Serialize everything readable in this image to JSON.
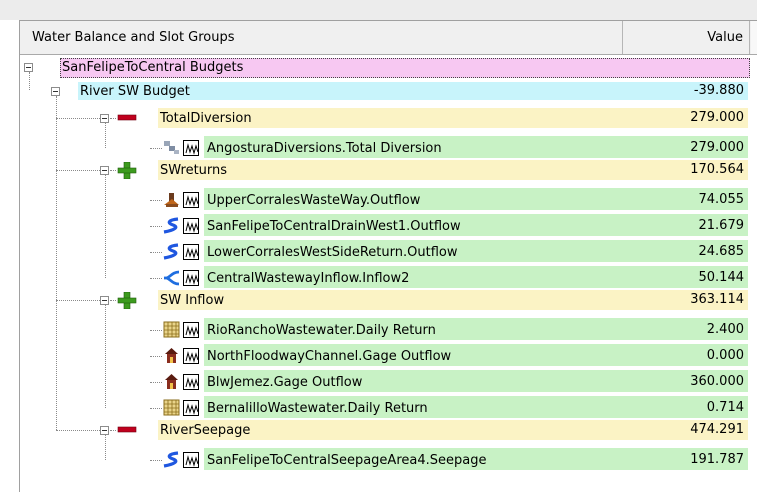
{
  "header": {
    "col_name": "Water Balance and Slot Groups",
    "col_value": "Value"
  },
  "colors": {
    "root_bg": "#f7c8f2",
    "budget_bg": "#c8f4fb",
    "group_bg": "#fbf3c5",
    "leaf_bg": "#c8f2c5",
    "minus_red": "#c0001e",
    "plus_green": "#3d9b1f"
  },
  "tree": {
    "root": {
      "label": "SanFelipeToCentral Budgets",
      "expanded": true
    },
    "budget": {
      "label": "River SW Budget",
      "value": "-39.880",
      "expanded": true
    },
    "groups": [
      {
        "label": "TotalDiversion",
        "value": "279.000",
        "sign": "minus-icon",
        "expanded": true,
        "items": [
          {
            "label": "AngosturaDiversions.Total Diversion",
            "value": "279.000",
            "icon": "diversion-object-icon"
          }
        ]
      },
      {
        "label": "SWreturns",
        "value": "170.564",
        "sign": "plus-icon",
        "expanded": true,
        "items": [
          {
            "label": "UpperCorralesWasteWay.Outflow",
            "value": "74.055",
            "icon": "pump-return-icon"
          },
          {
            "label": "SanFelipeToCentralDrainWest1.Outflow",
            "value": "21.679",
            "icon": "reach-icon"
          },
          {
            "label": "LowerCorralesWestSideReturn.Outflow",
            "value": "24.685",
            "icon": "reach-icon"
          },
          {
            "label": "CentralWastewayInflow.Inflow2",
            "value": "50.144",
            "icon": "confluence-icon"
          }
        ]
      },
      {
        "label": "SW Inflow",
        "value": "363.114",
        "sign": "plus-icon",
        "expanded": true,
        "items": [
          {
            "label": "RioRanchoWastewater.Daily Return",
            "value": "2.400",
            "icon": "data-table-icon"
          },
          {
            "label": "NorthFloodwayChannel.Gage Outflow",
            "value": "0.000",
            "icon": "gage-house-icon"
          },
          {
            "label": "BlwJemez.Gage Outflow",
            "value": "360.000",
            "icon": "gage-house-icon"
          },
          {
            "label": "BernalilloWastewater.Daily Return",
            "value": "0.714",
            "icon": "data-table-icon"
          }
        ]
      },
      {
        "label": "RiverSeepage",
        "value": "474.291",
        "sign": "minus-icon",
        "expanded": true,
        "items": [
          {
            "label": "SanFelipeToCentralSeepageArea4.Seepage",
            "value": "191.787",
            "icon": "reach-icon"
          }
        ]
      }
    ]
  }
}
